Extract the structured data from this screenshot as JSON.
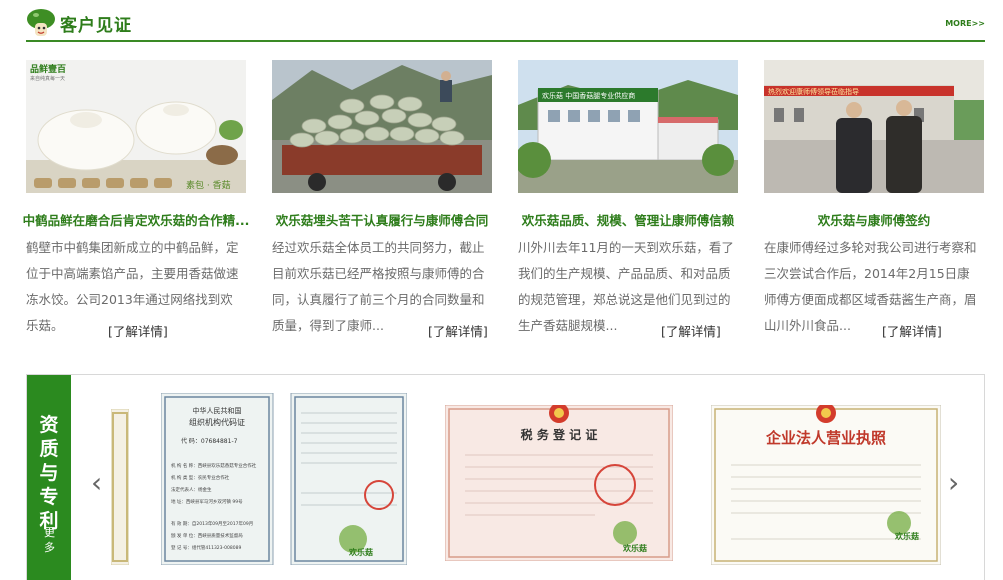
{
  "section": {
    "title": "客户见证",
    "more_label": "MORE>>"
  },
  "cards": [
    {
      "title": "中鹤品鲜在磨合后肯定欢乐菇的合作精...",
      "desc": "鹤壁市中鹤集团新成立的中鹤品鲜，定位于中高端素馅产品，主要用香菇做速冻水饺。公司2013年通过网络找到欢乐菇。",
      "more": "[了解详情]",
      "img_brand": "品鲜壹百",
      "img_brand_sub": "来自纯真每一天",
      "img_caption": "素包 · 香菇"
    },
    {
      "title": "欢乐菇埋头苦干认真履行与康师傅合同",
      "desc": "经过欢乐菇全体员工的共同努力，截止目前欢乐菇已经严格按照与康师傅的合同，认真履行了前三个月的合同数量和质量，得到了康师...",
      "more": "[了解详情]"
    },
    {
      "title": "欢乐菇品质、规模、管理让康师傅信赖",
      "desc": "川外川去年11月的一天到欢乐菇，看了我们的生产规模、产品品质、和对品质的规范管理，郑总说这是他们见到过的生产香菇腿规模...",
      "more": "[了解详情]",
      "img_sign": "欢乐菇 中国香菇腿专业供应商"
    },
    {
      "title": "欢乐菇与康师傅签约",
      "desc": "在康师傅经过多轮对我公司进行考察和三次尝试合作后，2014年2月15日康师傅方便面成都区域香菇酱生产商，眉山川外川食品...",
      "more": "[了解详情]",
      "img_banner": "热烈欢迎康师傅领导莅临指导"
    }
  ],
  "qualification": {
    "title": "资质与专利",
    "more_label": "更多",
    "prev_label": "‹",
    "next_label": "›",
    "certs": [
      {
        "name": "组织机构代码证",
        "header1": "中华人民共和国",
        "header2": "组织机构代码证",
        "code": "代 码：07684881-7",
        "lines": [
          "机 构 名 称：西峡县欢乐菇香菇专业合作社",
          "机 构 类 型：农民专业合作社",
          "法定代表人：杨金生",
          "地 址：西峡县军马河乡双河镇 99号",
          "有 效 期：自2013年09月至2017年09月",
          "颁 发 单 位：西峡县质量技术监督局",
          "登 记 号：组代管411323-008089"
        ],
        "watermark": "欢乐菇"
      },
      {
        "name": "税务登记证",
        "header1": "税 务 登 记 证",
        "watermark": "欢乐菇"
      },
      {
        "name": "企业法人营业执照",
        "header1": "企业法人营业执照",
        "watermark": "欢乐菇"
      }
    ]
  },
  "colors": {
    "brand_green": "#2b8a1f",
    "title_green": "#2e7d1b",
    "text_gray": "#6b6b6b"
  }
}
